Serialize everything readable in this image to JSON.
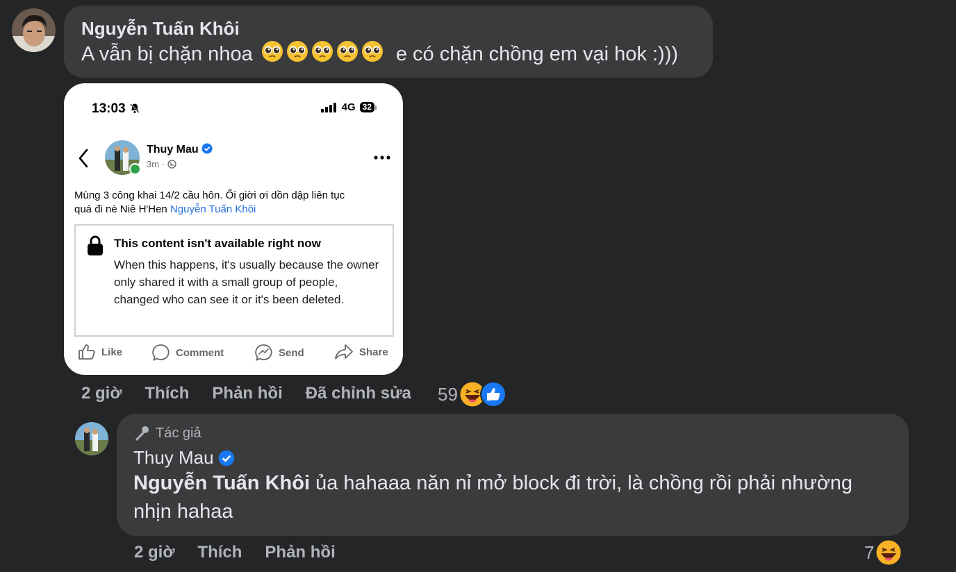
{
  "comment": {
    "author": "Nguyễn Tuấn Khôi",
    "text_before": "A vẫn bị chặn nhoa",
    "text_after": "e có chặn chồng em vại hok :)))",
    "emoji_count": 5,
    "actions": {
      "time": "2 giờ",
      "like": "Thích",
      "reply": "Phản hồi",
      "edited": "Đã chỉnh sửa"
    },
    "reaction_count": "59"
  },
  "screenshot": {
    "time": "13:03",
    "network": "4G",
    "battery": "32",
    "post": {
      "author": "Thuy Mau",
      "meta": "3m ·",
      "text_line1": "Mùng 3 công khai 14/2 cầu hôn.  Ối giời ơi dồn dập liên tục",
      "text_line2": "quá đi nè Niê H'Hen",
      "mention": "Nguyễn Tuấn Khôi",
      "unavailable_title": "This content isn't available right now",
      "unavailable_desc": "When this happens, it's usually because the owner only shared it with a small group of people, changed who can see it or it's been deleted.",
      "actions": {
        "like": "Like",
        "comment": "Comment",
        "send": "Send",
        "share": "Share"
      }
    }
  },
  "reply": {
    "badge": "Tác giả",
    "author": "Thuy Mau",
    "mention": "Nguyễn Tuấn Khôi",
    "text": "ủa hahaaa năn nỉ mở block đi trời, là chồng rồi phải nhường nhịn hahaa",
    "actions": {
      "time": "2 giờ",
      "like": "Thích",
      "reply": "Phản hồi"
    },
    "reaction_count": "7"
  },
  "colors": {
    "background": "#242526",
    "bubble": "#3a3b3c",
    "verified": "#1877f2",
    "link": "#216fdb"
  }
}
